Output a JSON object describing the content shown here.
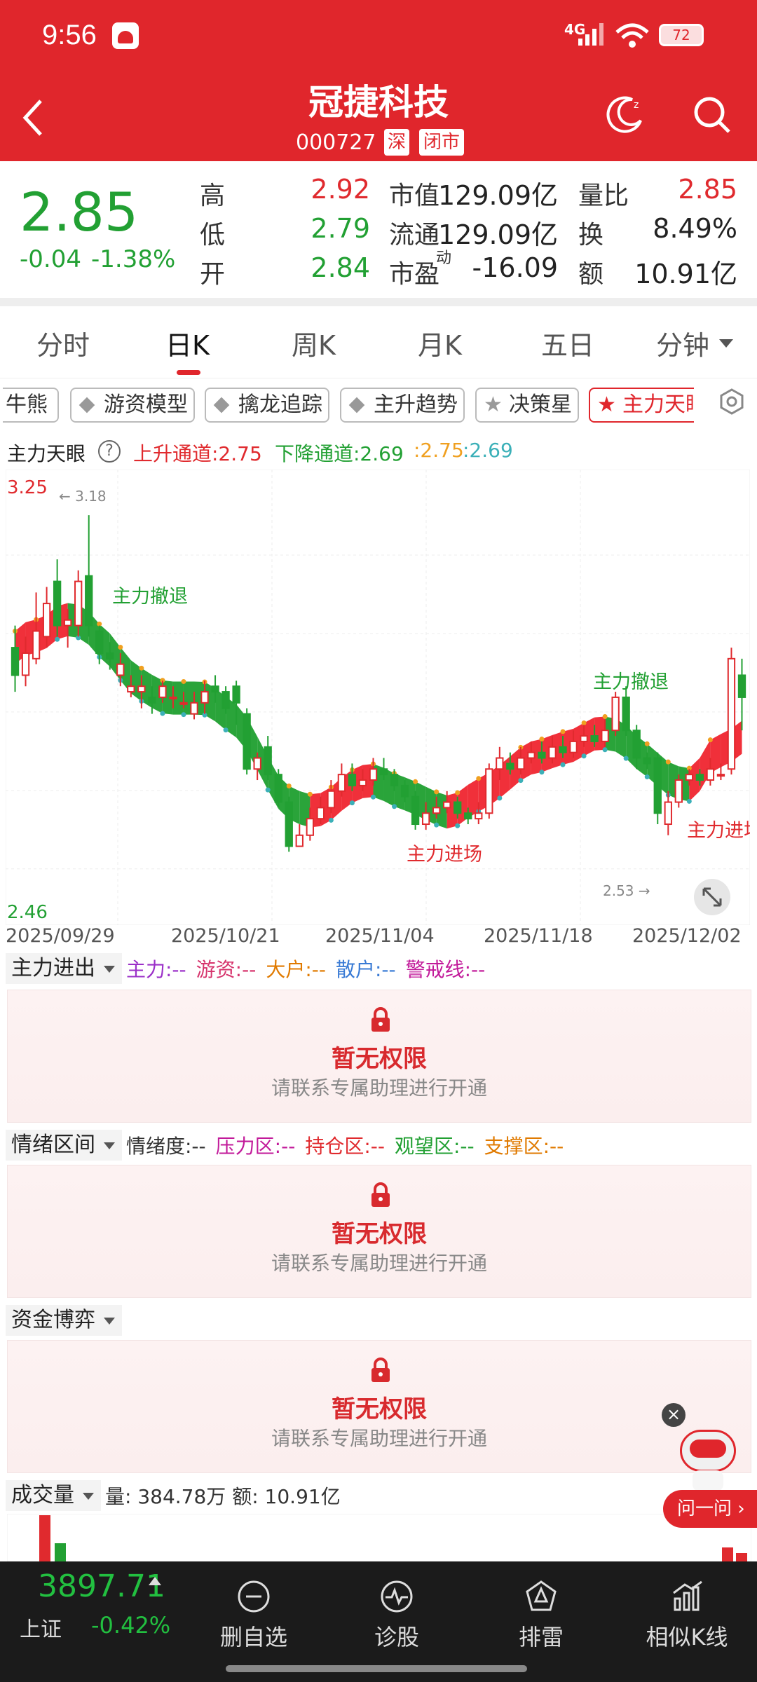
{
  "status": {
    "time": "9:56",
    "network": "4G",
    "battery": "72"
  },
  "header": {
    "title": "冠捷科技",
    "code": "000727",
    "market": "深",
    "state": "闭市"
  },
  "quote": {
    "price": "2.85",
    "change": "-0.04",
    "change_pct": "-1.38%",
    "high_label": "高",
    "high": "2.92",
    "low_label": "低",
    "low": "2.79",
    "open_label": "开",
    "open": "2.84",
    "mcap_label": "市值",
    "mcap": "129.09亿",
    "float_label": "流通",
    "float": "129.09亿",
    "pe_label": "市盈",
    "pe_sup": "动",
    "pe": "-16.09",
    "vr_label": "量比",
    "vr": "2.85",
    "turn_label": "换",
    "turn": "8.49%",
    "amt_label": "额",
    "amt": "10.91亿"
  },
  "tabs": [
    "分时",
    "日K",
    "周K",
    "月K",
    "五日",
    "分钟"
  ],
  "indicators": [
    "牛熊",
    "游资模型",
    "擒龙追踪",
    "主升趋势",
    "决策星",
    "主力天眼"
  ],
  "chart_legend": {
    "name": "主力天眼",
    "q": "?",
    "up": "上升通道:2.75",
    "down": "下降通道:2.69",
    "v1": ":2.75",
    "v2": ":2.69"
  },
  "chart_data": {
    "type": "candlestick",
    "ymax": "3.25",
    "ymin": "2.46",
    "max_mark": "← 3.18",
    "min_mark": "2.53 →",
    "dates": [
      "2025/09/29",
      "2025/10/21",
      "2025/11/04",
      "2025/11/18",
      "2025/12/02"
    ],
    "annotations": [
      "主力撤退",
      "主力撤退",
      "主力进场",
      "主力进场"
    ],
    "candles": [
      [
        2.94,
        2.89,
        2.98,
        2.86
      ],
      [
        2.89,
        2.93,
        2.96,
        2.87
      ],
      [
        2.92,
        2.97,
        3.04,
        2.91
      ],
      [
        2.96,
        3.02,
        3.05,
        2.94
      ],
      [
        3.06,
        2.98,
        3.1,
        2.96
      ],
      [
        2.98,
        2.99,
        3.01,
        2.94
      ],
      [
        2.98,
        3.06,
        3.08,
        2.96
      ],
      [
        3.07,
        2.98,
        3.18,
        2.96
      ],
      [
        2.97,
        2.93,
        2.98,
        2.91
      ],
      [
        2.93,
        2.92,
        2.95,
        2.9
      ],
      [
        2.89,
        2.91,
        2.93,
        2.87
      ],
      [
        2.86,
        2.87,
        2.89,
        2.85
      ],
      [
        2.86,
        2.87,
        2.89,
        2.83
      ],
      [
        2.85,
        2.84,
        2.87,
        2.82
      ],
      [
        2.85,
        2.87,
        2.88,
        2.84
      ],
      [
        2.85,
        2.85,
        2.87,
        2.83
      ],
      [
        2.84,
        2.84,
        2.86,
        2.83
      ],
      [
        2.82,
        2.84,
        2.86,
        2.81
      ],
      [
        2.84,
        2.86,
        2.88,
        2.82
      ],
      [
        2.87,
        2.86,
        2.89,
        2.84
      ],
      [
        2.86,
        2.83,
        2.87,
        2.82
      ],
      [
        2.87,
        2.84,
        2.88,
        2.8
      ],
      [
        2.82,
        2.72,
        2.83,
        2.71
      ],
      [
        2.72,
        2.74,
        2.75,
        2.7
      ],
      [
        2.76,
        2.71,
        2.78,
        2.7
      ],
      [
        2.71,
        2.66,
        2.72,
        2.65
      ],
      [
        2.66,
        2.58,
        2.67,
        2.57
      ],
      [
        2.58,
        2.6,
        2.62,
        2.58
      ],
      [
        2.6,
        2.63,
        2.65,
        2.59
      ],
      [
        2.63,
        2.65,
        2.67,
        2.62
      ],
      [
        2.65,
        2.68,
        2.7,
        2.64
      ],
      [
        2.68,
        2.71,
        2.73,
        2.67
      ],
      [
        2.71,
        2.69,
        2.73,
        2.68
      ],
      [
        2.69,
        2.7,
        2.72,
        2.68
      ],
      [
        2.7,
        2.72,
        2.74,
        2.69
      ],
      [
        2.72,
        2.71,
        2.74,
        2.7
      ],
      [
        2.71,
        2.69,
        2.72,
        2.68
      ],
      [
        2.69,
        2.67,
        2.7,
        2.66
      ],
      [
        2.67,
        2.62,
        2.68,
        2.61
      ],
      [
        2.62,
        2.64,
        2.66,
        2.61
      ],
      [
        2.64,
        2.65,
        2.67,
        2.63
      ],
      [
        2.65,
        2.66,
        2.68,
        2.64
      ],
      [
        2.66,
        2.64,
        2.67,
        2.63
      ],
      [
        2.64,
        2.63,
        2.65,
        2.62
      ],
      [
        2.63,
        2.64,
        2.66,
        2.62
      ],
      [
        2.64,
        2.72,
        2.73,
        2.63
      ],
      [
        2.72,
        2.74,
        2.76,
        2.7
      ],
      [
        2.73,
        2.72,
        2.75,
        2.71
      ],
      [
        2.72,
        2.74,
        2.76,
        2.71
      ],
      [
        2.74,
        2.75,
        2.77,
        2.73
      ],
      [
        2.75,
        2.74,
        2.77,
        2.73
      ],
      [
        2.74,
        2.76,
        2.78,
        2.73
      ],
      [
        2.76,
        2.75,
        2.78,
        2.74
      ],
      [
        2.75,
        2.77,
        2.79,
        2.74
      ],
      [
        2.77,
        2.78,
        2.8,
        2.76
      ],
      [
        2.78,
        2.77,
        2.8,
        2.76
      ],
      [
        2.77,
        2.79,
        2.81,
        2.76
      ],
      [
        2.79,
        2.85,
        2.86,
        2.78
      ],
      [
        2.85,
        2.79,
        2.87,
        2.78
      ],
      [
        2.79,
        2.74,
        2.8,
        2.72
      ],
      [
        2.74,
        2.73,
        2.75,
        2.72
      ],
      [
        2.74,
        2.64,
        2.75,
        2.62
      ],
      [
        2.62,
        2.66,
        2.68,
        2.6
      ],
      [
        2.66,
        2.7,
        2.71,
        2.65
      ],
      [
        2.7,
        2.71,
        2.72,
        2.69
      ],
      [
        2.71,
        2.7,
        2.72,
        2.69
      ],
      [
        2.7,
        2.72,
        2.74,
        2.69
      ],
      [
        2.71,
        2.71,
        2.73,
        2.7
      ],
      [
        2.72,
        2.92,
        2.94,
        2.71
      ],
      [
        2.89,
        2.85,
        2.92,
        2.79
      ]
    ]
  },
  "sections": [
    {
      "button": "主力进出",
      "legend": [
        {
          "t": "主力:--",
          "c": "#9b30c8"
        },
        {
          "t": "游资:--",
          "c": "#d6336c"
        },
        {
          "t": "大户:--",
          "c": "#e07a00"
        },
        {
          "t": "散户:--",
          "c": "#3a7bd5"
        },
        {
          "t": "警戒线:--",
          "c": "#c21a9a"
        }
      ]
    },
    {
      "button": "情绪区间",
      "legend": [
        {
          "t": "情绪度:--",
          "c": "#333"
        },
        {
          "t": "压力区:--",
          "c": "#c21a9a"
        },
        {
          "t": "持仓区:--",
          "c": "#e02a2e"
        },
        {
          "t": "观望区:--",
          "c": "#22a033"
        },
        {
          "t": "支撑区:--",
          "c": "#e07a00"
        }
      ]
    },
    {
      "button": "资金博弈",
      "legend": []
    }
  ],
  "locked": {
    "title": "暂无权限",
    "sub": "请联系专属助理进行开通"
  },
  "volume": {
    "button": "成交量",
    "text": "量: 384.78万  额: 10.91亿"
  },
  "assistant": {
    "label": "问一问"
  },
  "bottom": {
    "index_value": "3897.71",
    "index_name": "上证",
    "index_change": "-0.42%",
    "items": [
      "删自选",
      "诊股",
      "排雷",
      "相似K线"
    ]
  },
  "colors": {
    "brand": "#e0262c",
    "up": "#e02a2e",
    "down": "#22a033"
  }
}
